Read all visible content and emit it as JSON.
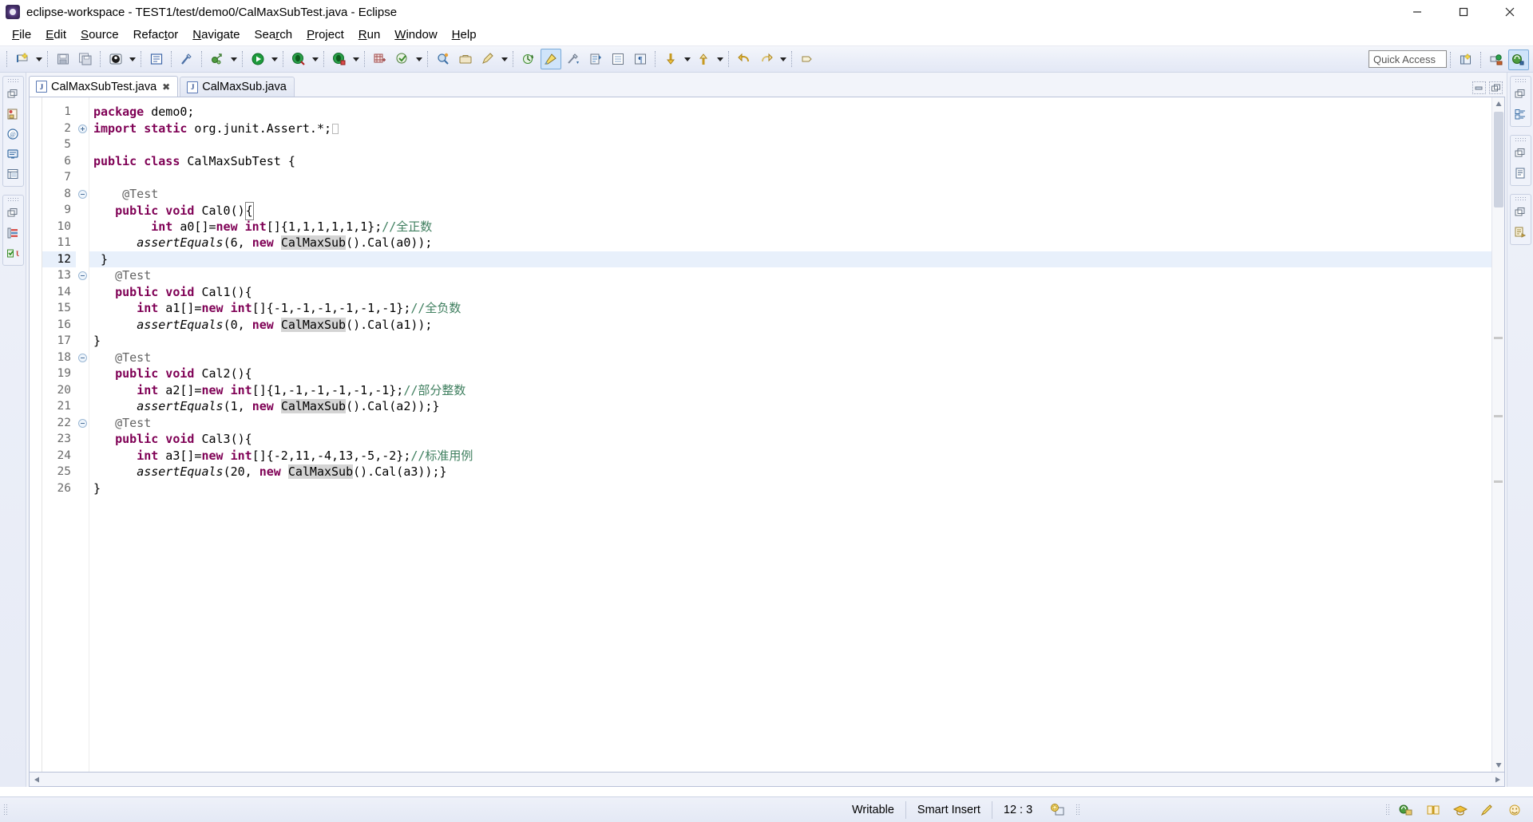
{
  "window": {
    "title": "eclipse-workspace - TEST1/test/demo0/CalMaxSubTest.java - Eclipse",
    "app_icon": "eclipse-icon",
    "controls": {
      "minimize": "minimize-icon",
      "maximize": "maximize-icon",
      "close": "close-icon"
    }
  },
  "menubar": {
    "items": [
      {
        "label": "File",
        "mnemonic": "F"
      },
      {
        "label": "Edit",
        "mnemonic": "E"
      },
      {
        "label": "Source",
        "mnemonic": "S"
      },
      {
        "label": "Refactor",
        "mnemonic": "t"
      },
      {
        "label": "Navigate",
        "mnemonic": "N"
      },
      {
        "label": "Search",
        "mnemonic": "r"
      },
      {
        "label": "Project",
        "mnemonic": "P"
      },
      {
        "label": "Run",
        "mnemonic": "R"
      },
      {
        "label": "Window",
        "mnemonic": "W"
      },
      {
        "label": "Help",
        "mnemonic": "H"
      }
    ]
  },
  "toolbar": {
    "quick_access": {
      "placeholder": "Quick Access",
      "value": "Quick Access"
    },
    "buttons": [
      {
        "name": "new-wizard-icon",
        "tooltip": "New"
      },
      {
        "name": "new-wizard-dropdown-icon",
        "tooltip": "New menu"
      },
      {
        "name": "save-icon",
        "tooltip": "Save"
      },
      {
        "name": "save-all-icon",
        "tooltip": "Save All"
      },
      {
        "name": "print-icon",
        "tooltip": "Print"
      },
      {
        "name": "print-dropdown-icon",
        "tooltip": "Print menu"
      },
      {
        "name": "new-java-class-icon",
        "tooltip": "New Java Class"
      },
      {
        "name": "toggle-markers-icon",
        "tooltip": "Toggle Mark Occurrences"
      },
      {
        "name": "external-tools-icon",
        "tooltip": "External Tools"
      },
      {
        "name": "external-tools-dropdown-icon",
        "tooltip": "External Tools menu"
      },
      {
        "name": "run-icon",
        "tooltip": "Run"
      },
      {
        "name": "run-dropdown-icon",
        "tooltip": "Run menu"
      },
      {
        "name": "debug-icon",
        "tooltip": "Debug"
      },
      {
        "name": "debug-dropdown-icon",
        "tooltip": "Debug menu"
      },
      {
        "name": "coverage-icon",
        "tooltip": "Coverage"
      },
      {
        "name": "coverage-dropdown-icon",
        "tooltip": "Coverage menu"
      },
      {
        "name": "new-package-icon",
        "tooltip": "New Java Package"
      },
      {
        "name": "open-type-icon",
        "tooltip": "Open Type"
      },
      {
        "name": "open-type-dropdown-icon",
        "tooltip": "Open Type menu"
      },
      {
        "name": "search-icon",
        "tooltip": "Search"
      },
      {
        "name": "open-task-icon",
        "tooltip": "Open Task"
      },
      {
        "name": "edit-icon",
        "tooltip": "Edit"
      },
      {
        "name": "edit-dropdown-icon",
        "tooltip": "Edit menu"
      },
      {
        "name": "refresh-icon",
        "tooltip": "Refresh"
      },
      {
        "name": "pencil-highlight-icon",
        "tooltip": "Toggle Block Selection"
      },
      {
        "name": "next-annotation-icon",
        "tooltip": "Next Annotation"
      },
      {
        "name": "previous-annotation-icon",
        "tooltip": "Previous Annotation"
      },
      {
        "name": "last-edit-location-icon",
        "tooltip": "Last Edit Location"
      },
      {
        "name": "show-whitespace-icon",
        "tooltip": "Show Whitespace Characters"
      },
      {
        "name": "next-edit-icon",
        "tooltip": "Next Edit"
      },
      {
        "name": "next-edit-dropdown-icon",
        "tooltip": "Next Edit menu"
      },
      {
        "name": "previous-edit-icon",
        "tooltip": "Previous Edit"
      },
      {
        "name": "previous-edit-dropdown-icon",
        "tooltip": "Previous Edit menu"
      },
      {
        "name": "back-icon",
        "tooltip": "Back"
      },
      {
        "name": "forward-icon",
        "tooltip": "Forward"
      },
      {
        "name": "forward-dropdown-icon",
        "tooltip": "Forward menu"
      },
      {
        "name": "pin-editor-icon",
        "tooltip": "Pin Editor"
      }
    ],
    "perspective_buttons": [
      {
        "name": "open-perspective-icon",
        "tooltip": "Open Perspective"
      },
      {
        "name": "perspective-debug-icon",
        "tooltip": "Debug perspective"
      },
      {
        "name": "perspective-java-icon",
        "tooltip": "Java perspective"
      }
    ]
  },
  "left_rail": {
    "groups": [
      {
        "name": "package-explorer-group",
        "icons": [
          "restore-icon",
          "package-explorer-icon",
          "javadoc-icon",
          "console-icon",
          "outline-icon"
        ]
      },
      {
        "name": "junit-group",
        "icons": [
          "restore-icon",
          "task-list-icon",
          "junit-icon"
        ]
      }
    ]
  },
  "right_rail": {
    "groups": [
      {
        "name": "outline-group",
        "icons": [
          "restore-icon",
          "outline-view-icon"
        ]
      },
      {
        "name": "tasks-group",
        "icons": [
          "restore-icon",
          "task-list-view-icon"
        ]
      },
      {
        "name": "templates-group",
        "icons": [
          "restore-icon",
          "templates-view-icon"
        ]
      }
    ]
  },
  "editor": {
    "tabs": [
      {
        "label": "CalMaxSubTest.java",
        "icon": "java-file-icon",
        "selected": true,
        "closable": true
      },
      {
        "label": "CalMaxSub.java",
        "icon": "java-file-icon",
        "selected": false,
        "closable": false
      }
    ],
    "tab_controls": [
      {
        "name": "minimize-editor-icon"
      },
      {
        "name": "maximize-editor-icon"
      }
    ],
    "line_numbers": [
      "1",
      "2",
      "5",
      "6",
      "7",
      "8",
      "9",
      "10",
      "11",
      "12",
      "13",
      "14",
      "15",
      "16",
      "17",
      "18",
      "19",
      "20",
      "21",
      "22",
      "23",
      "24",
      "25",
      "26"
    ],
    "current_line": "12",
    "fold_markers": {
      "2": "plus",
      "8": "minus",
      "13": "minus",
      "18": "minus",
      "22": "minus"
    },
    "lines": [
      {
        "num": "1",
        "segments": [
          {
            "t": "package",
            "c": "kw"
          },
          {
            "t": " demo0;",
            "c": "plain"
          }
        ]
      },
      {
        "num": "2",
        "segments": [
          {
            "t": "import static",
            "c": "kw"
          },
          {
            "t": " org.junit.Assert.*;",
            "c": "plain"
          },
          {
            "t": "",
            "c": "imp-box"
          }
        ]
      },
      {
        "num": "5",
        "segments": []
      },
      {
        "num": "6",
        "segments": [
          {
            "t": "public class",
            "c": "kw"
          },
          {
            "t": " CalMaxSubTest {",
            "c": "plain"
          }
        ]
      },
      {
        "num": "7",
        "segments": []
      },
      {
        "num": "8",
        "segments": [
          {
            "t": "    @Test",
            "c": "ann"
          }
        ]
      },
      {
        "num": "9",
        "segments": [
          {
            "t": "   ",
            "c": "plain"
          },
          {
            "t": "public void",
            "c": "kw"
          },
          {
            "t": " Cal0()",
            "c": "plain"
          },
          {
            "t": "{",
            "c": "caret-brace"
          }
        ]
      },
      {
        "num": "10",
        "segments": [
          {
            "t": "        ",
            "c": "plain"
          },
          {
            "t": "int",
            "c": "kw"
          },
          {
            "t": " a0[]=",
            "c": "plain"
          },
          {
            "t": "new int",
            "c": "kw"
          },
          {
            "t": "[]{1,1,1,1,1,1};",
            "c": "plain"
          },
          {
            "t": "//全正数",
            "c": "cm"
          }
        ]
      },
      {
        "num": "11",
        "segments": [
          {
            "t": "      ",
            "c": "plain"
          },
          {
            "t": "assertEquals",
            "c": "it"
          },
          {
            "t": "(6, ",
            "c": "plain"
          },
          {
            "t": "new",
            "c": "kw"
          },
          {
            "t": " ",
            "c": "plain"
          },
          {
            "t": "CalMaxSub",
            "c": "hl"
          },
          {
            "t": "().Cal(a0));",
            "c": "plain"
          }
        ]
      },
      {
        "num": "12",
        "segments": [
          {
            "t": " }",
            "c": "plain"
          }
        ]
      },
      {
        "num": "13",
        "segments": [
          {
            "t": "   @Test",
            "c": "ann"
          }
        ]
      },
      {
        "num": "14",
        "segments": [
          {
            "t": "   ",
            "c": "plain"
          },
          {
            "t": "public void",
            "c": "kw"
          },
          {
            "t": " Cal1(){",
            "c": "plain"
          }
        ]
      },
      {
        "num": "15",
        "segments": [
          {
            "t": "      ",
            "c": "plain"
          },
          {
            "t": "int",
            "c": "kw"
          },
          {
            "t": " a1[]=",
            "c": "plain"
          },
          {
            "t": "new int",
            "c": "kw"
          },
          {
            "t": "[]{-1,-1,-1,-1,-1,-1};",
            "c": "plain"
          },
          {
            "t": "//全负数",
            "c": "cm"
          }
        ]
      },
      {
        "num": "16",
        "segments": [
          {
            "t": "      ",
            "c": "plain"
          },
          {
            "t": "assertEquals",
            "c": "it"
          },
          {
            "t": "(0, ",
            "c": "plain"
          },
          {
            "t": "new",
            "c": "kw"
          },
          {
            "t": " ",
            "c": "plain"
          },
          {
            "t": "CalMaxSub",
            "c": "hl"
          },
          {
            "t": "().Cal(a1));",
            "c": "plain"
          }
        ]
      },
      {
        "num": "17",
        "segments": [
          {
            "t": "}",
            "c": "plain"
          }
        ]
      },
      {
        "num": "18",
        "segments": [
          {
            "t": "   @Test",
            "c": "ann"
          }
        ]
      },
      {
        "num": "19",
        "segments": [
          {
            "t": "   ",
            "c": "plain"
          },
          {
            "t": "public void",
            "c": "kw"
          },
          {
            "t": " Cal2(){",
            "c": "plain"
          }
        ]
      },
      {
        "num": "20",
        "segments": [
          {
            "t": "      ",
            "c": "plain"
          },
          {
            "t": "int",
            "c": "kw"
          },
          {
            "t": " a2[]=",
            "c": "plain"
          },
          {
            "t": "new int",
            "c": "kw"
          },
          {
            "t": "[]{1,-1,-1,-1,-1,-1};",
            "c": "plain"
          },
          {
            "t": "//部分整数",
            "c": "cm"
          }
        ]
      },
      {
        "num": "21",
        "segments": [
          {
            "t": "      ",
            "c": "plain"
          },
          {
            "t": "assertEquals",
            "c": "it"
          },
          {
            "t": "(1, ",
            "c": "plain"
          },
          {
            "t": "new",
            "c": "kw"
          },
          {
            "t": " ",
            "c": "plain"
          },
          {
            "t": "CalMaxSub",
            "c": "hl"
          },
          {
            "t": "().Cal(a2));}",
            "c": "plain"
          }
        ]
      },
      {
        "num": "22",
        "segments": [
          {
            "t": "   @Test",
            "c": "ann"
          }
        ]
      },
      {
        "num": "23",
        "segments": [
          {
            "t": "   ",
            "c": "plain"
          },
          {
            "t": "public void",
            "c": "kw"
          },
          {
            "t": " Cal3(){",
            "c": "plain"
          }
        ]
      },
      {
        "num": "24",
        "segments": [
          {
            "t": "      ",
            "c": "plain"
          },
          {
            "t": "int",
            "c": "kw"
          },
          {
            "t": " a3[]=",
            "c": "plain"
          },
          {
            "t": "new int",
            "c": "kw"
          },
          {
            "t": "[]{-2,11,-4,13,-5,-2};",
            "c": "plain"
          },
          {
            "t": "//标准用例",
            "c": "cm"
          }
        ]
      },
      {
        "num": "25",
        "segments": [
          {
            "t": "      ",
            "c": "plain"
          },
          {
            "t": "assertEquals",
            "c": "it"
          },
          {
            "t": "(20, ",
            "c": "plain"
          },
          {
            "t": "new",
            "c": "kw"
          },
          {
            "t": " ",
            "c": "plain"
          },
          {
            "t": "CalMaxSub",
            "c": "hl"
          },
          {
            "t": "().Cal(a3));}",
            "c": "plain"
          }
        ]
      },
      {
        "num": "26",
        "segments": [
          {
            "t": "}",
            "c": "plain"
          }
        ]
      }
    ]
  },
  "statusbar": {
    "writable": "Writable",
    "insert_mode": "Smart Insert",
    "cursor_position": "12 : 3",
    "build_icon": "build-status-icon",
    "right_icons": [
      "editor-area-icon",
      "book-icon",
      "graduation-cap-icon",
      "pencil-icon",
      "smiley-icon"
    ]
  },
  "colors": {
    "keyword": "#7f0055",
    "comment": "#3f7f5f",
    "annotation": "#646464",
    "occurrence_highlight": "#d4d4d4",
    "current_line": "#e8f0fb",
    "chrome": "#e4e9f5"
  }
}
